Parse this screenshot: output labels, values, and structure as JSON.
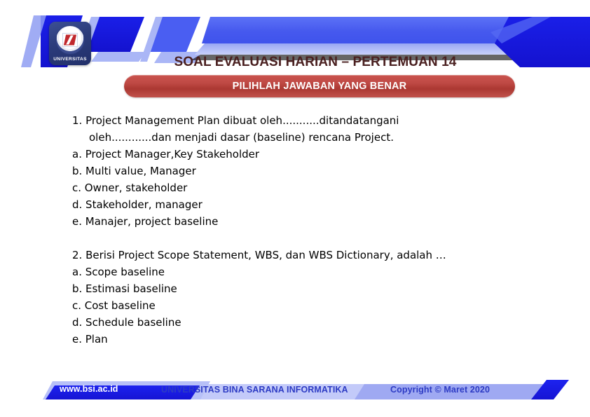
{
  "slide": {
    "title": "SOAL EVALUASI HARIAN – PERTEMUAN 14",
    "subtitle_banner": "PILIHLAH JAWABAN YANG BENAR"
  },
  "logo": {
    "name": "bsi-university-logo",
    "word": "UNIVERSITAS"
  },
  "questions": [
    {
      "stem_line1": "1. Project Management Plan dibuat oleh...........ditandatangani",
      "stem_line2": "oleh............dan menjadi dasar (baseline) rencana Project.",
      "options": [
        "a. Project Manager,Key Stakeholder",
        "b. Multi value, Manager",
        "c. Owner, stakeholder",
        "d. Stakeholder, manager",
        "e. Manajer, project baseline"
      ]
    },
    {
      "stem_line1": "2. Berisi Project Scope Statement, WBS, dan WBS Dictionary, adalah …",
      "stem_line2": "",
      "options": [
        "a. Scope baseline",
        "b. Estimasi baseline",
        "c. Cost baseline",
        "d. Schedule baseline",
        "e. Plan"
      ]
    }
  ],
  "footer": {
    "url": "www.bsi.ac.id",
    "organization": "UNIVERSITAS BINA SARANA INFORMATIKA",
    "copyright": "Copyright © Maret 2020"
  },
  "colors": {
    "title_text": "#4a2020",
    "banner_red": "#c0453f",
    "footer_blue": "#2d3bc4",
    "stripe_dark_blue": "#1516e0",
    "stripe_mid_blue": "#4f63f0",
    "stripe_light_blue": "#a8b4f5",
    "logo_navy": "#2b3b7a"
  }
}
